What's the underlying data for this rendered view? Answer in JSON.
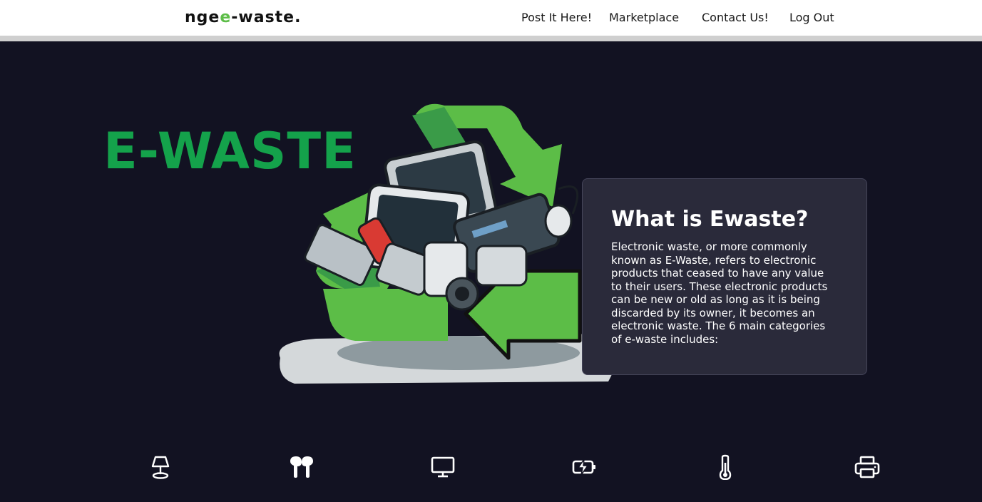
{
  "header": {
    "logo": {
      "part1": "nge",
      "accent": "e",
      "part2": "-waste."
    },
    "nav": [
      {
        "label": "Post It Here!"
      },
      {
        "label": "Marketplace"
      },
      {
        "label": "Contact Us!"
      },
      {
        "label": "Log Out"
      }
    ]
  },
  "hero": {
    "title": "E-WASTE",
    "art_icon": "recycle-electronics-illustration"
  },
  "info_card": {
    "heading": "What is Ewaste?",
    "body": "Electronic waste, or more commonly known as E-Waste, refers to electronic products that ceased to have any value to their users. These electronic products can be new or old as long as it is being discarded by its owner, it becomes an electronic waste. The 6 main categories of e-waste includes:"
  },
  "categories": {
    "icons": [
      "lamp-icon",
      "earbuds-icon",
      "monitor-icon",
      "battery-charging-icon",
      "thermometer-icon",
      "printer-icon"
    ]
  },
  "colors": {
    "background": "#121222",
    "brand_green": "#14a24b",
    "logo_accent": "#5cbd47",
    "recycle_light_green": "#5cbd47",
    "recycle_dark_green": "#3a9b48",
    "card_background": "#2a2a3a"
  }
}
